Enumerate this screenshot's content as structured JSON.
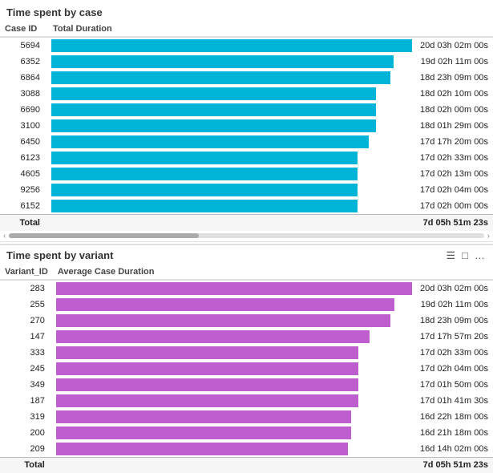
{
  "section1": {
    "title": "Time spent by case",
    "columns": [
      "Case ID",
      "Total Duration"
    ],
    "rows": [
      {
        "id": "5694",
        "duration": "20d 03h 02m 00s",
        "bar_pct": 100
      },
      {
        "id": "6352",
        "duration": "19d 02h 11m 00s",
        "bar_pct": 95
      },
      {
        "id": "6864",
        "duration": "18d 23h 09m 00s",
        "bar_pct": 94
      },
      {
        "id": "3088",
        "duration": "18d 02h 10m 00s",
        "bar_pct": 90
      },
      {
        "id": "6690",
        "duration": "18d 02h 00m 00s",
        "bar_pct": 90
      },
      {
        "id": "3100",
        "duration": "18d 01h 29m 00s",
        "bar_pct": 90
      },
      {
        "id": "6450",
        "duration": "17d 17h 20m 00s",
        "bar_pct": 88
      },
      {
        "id": "6123",
        "duration": "17d 02h 33m 00s",
        "bar_pct": 85
      },
      {
        "id": "4605",
        "duration": "17d 02h 13m 00s",
        "bar_pct": 85
      },
      {
        "id": "9256",
        "duration": "17d 02h 04m 00s",
        "bar_pct": 85
      },
      {
        "id": "6152",
        "duration": "17d 02h 00m 00s",
        "bar_pct": 85
      }
    ],
    "total_label": "Total",
    "total_value": "7d 05h 51m 23s"
  },
  "section2": {
    "title": "Time spent by variant",
    "columns": [
      "Variant_ID",
      "Average Case Duration"
    ],
    "icons": [
      "filter",
      "expand",
      "more"
    ],
    "rows": [
      {
        "id": "283",
        "duration": "20d 03h 02m 00s",
        "bar_pct": 100
      },
      {
        "id": "255",
        "duration": "19d 02h 11m 00s",
        "bar_pct": 95
      },
      {
        "id": "270",
        "duration": "18d 23h 09m 00s",
        "bar_pct": 94
      },
      {
        "id": "147",
        "duration": "17d 17h 57m 20s",
        "bar_pct": 88
      },
      {
        "id": "333",
        "duration": "17d 02h 33m 00s",
        "bar_pct": 85
      },
      {
        "id": "245",
        "duration": "17d 02h 04m 00s",
        "bar_pct": 85
      },
      {
        "id": "349",
        "duration": "17d 01h 50m 00s",
        "bar_pct": 85
      },
      {
        "id": "187",
        "duration": "17d 01h 41m 30s",
        "bar_pct": 85
      },
      {
        "id": "319",
        "duration": "16d 22h 18m 00s",
        "bar_pct": 83
      },
      {
        "id": "200",
        "duration": "16d 21h 18m 00s",
        "bar_pct": 83
      },
      {
        "id": "209",
        "duration": "16d 14h 02m 00s",
        "bar_pct": 82
      }
    ],
    "total_label": "Total",
    "total_value": "7d 05h 51m 23s"
  }
}
